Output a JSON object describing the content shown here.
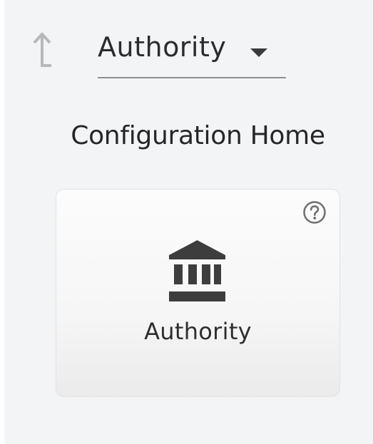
{
  "header": {
    "back_icon": "up-arrow-icon",
    "context_selector": {
      "value": "Authority",
      "icon": "caret-down-icon"
    }
  },
  "main": {
    "title": "Configuration Home",
    "tiles": [
      {
        "label": "Authority",
        "icon": "bank-icon",
        "help_icon": "question-circle-icon"
      }
    ]
  },
  "colors": {
    "background": "#f3f4f6",
    "tile_background": "#f8f8f8",
    "text": "#2c2c2c",
    "icon_dark": "#3d3d3d",
    "icon_muted": "#b8b8b8"
  }
}
